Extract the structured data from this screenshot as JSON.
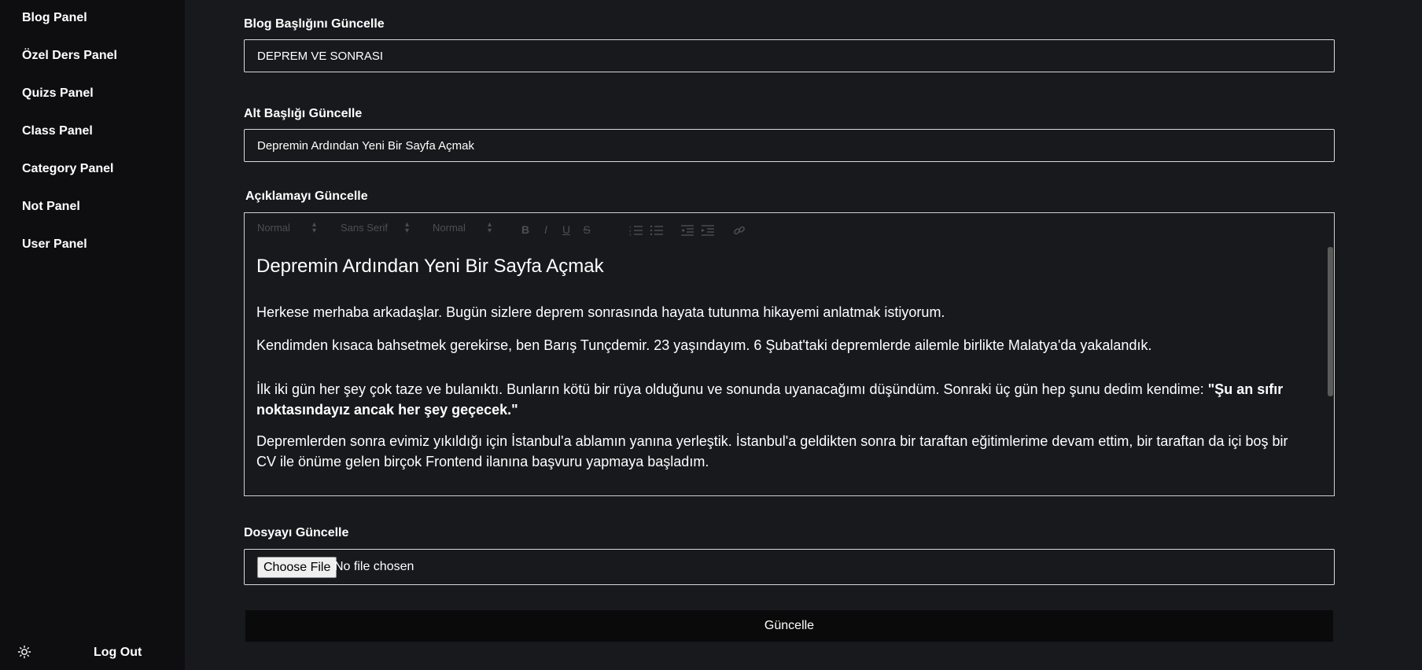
{
  "sidebar": {
    "items": [
      {
        "label": "Blog Panel"
      },
      {
        "label": "Özel Ders Panel"
      },
      {
        "label": "Quizs Panel"
      },
      {
        "label": "Class Panel"
      },
      {
        "label": "Category Panel"
      },
      {
        "label": "Not Panel"
      },
      {
        "label": "User Panel"
      }
    ],
    "theme_icon": "sun-icon",
    "logout_label": "Log Out"
  },
  "form": {
    "title_label": "Blog Başlığını Güncelle",
    "title_value": "DEPREM VE SONRASI",
    "subtitle_label": "Alt Başlığı Güncelle",
    "subtitle_value": "Depremin Ardından Yeni Bir Sayfa Açmak",
    "description_label": "Açıklamayı Güncelle",
    "toolbar": {
      "heading_picker": "Normal",
      "font_picker": "Sans Serif",
      "size_picker": "Normal",
      "buttons": [
        "bold-icon",
        "italic-icon",
        "underline-icon",
        "strike-icon",
        "ordered-list-icon",
        "bullet-list-icon",
        "outdent-icon",
        "indent-icon",
        "link-icon"
      ]
    },
    "editor": {
      "heading": "Depremin Ardından Yeni Bir Sayfa Açmak",
      "p1": " Herkese merhaba arkadaşlar. Bugün sizlere deprem sonrasında hayata tutunma hikayemi anlatmak istiyorum.",
      "p2": " Kendimden kısaca bahsetmek gerekirse, ben Barış Tunçdemir. 23 yaşındayım. 6 Şubat'taki depremlerde ailemle birlikte Malatya'da yakalandık.",
      "p3": "İlk iki gün her şey çok taze ve bulanıktı. Bunların kötü bir rüya olduğunu ve sonunda uyanacağımı düşündüm. Sonraki üç gün hep şunu dedim kendime: ",
      "p3_bold": "\"Şu an sıfır noktasındayız ancak her şey geçecek.\"",
      "p4": "Depremlerden sonra evimiz yıkıldığı için İstanbul'a ablamın yanına yerleştik. İstanbul'a geldikten sonra bir taraftan eğitimlerime devam ettim, bir taraftan da içi boş bir CV ile önüme gelen birçok Frontend ilanına başvuru yapmaya başladım."
    },
    "file_label": "Dosyayı Güncelle",
    "file_button": "Choose File",
    "file_status": "No file chosen",
    "submit_label": "Güncelle"
  }
}
